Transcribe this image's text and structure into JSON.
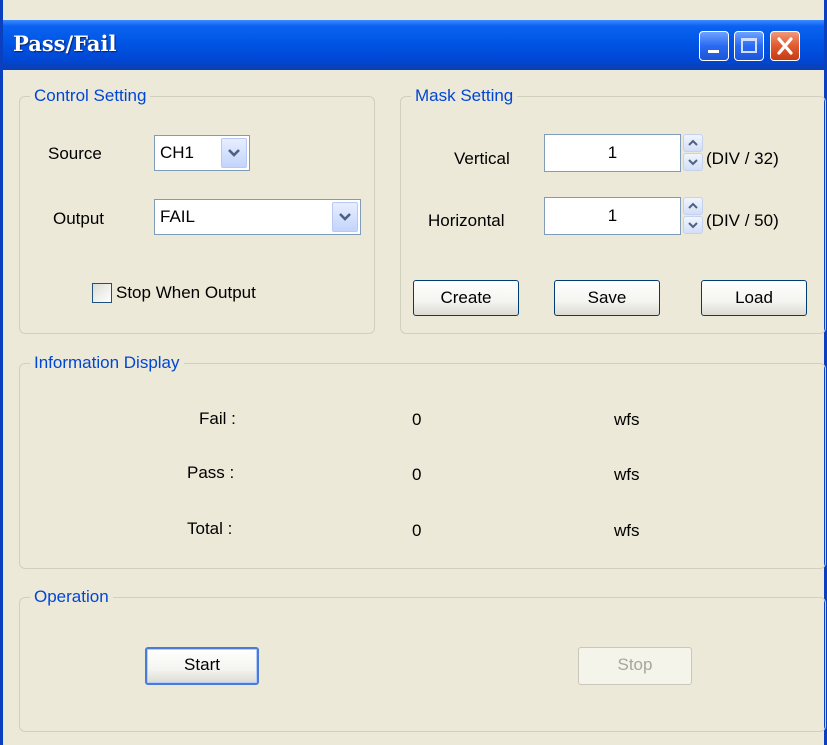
{
  "window": {
    "title": "Pass/Fail"
  },
  "control_setting": {
    "legend": "Control Setting",
    "source_label": "Source",
    "source_value": "CH1",
    "output_label": "Output",
    "output_value": "FAIL",
    "stop_when_output_label": "Stop When Output",
    "stop_when_output_checked": false
  },
  "mask_setting": {
    "legend": "Mask Setting",
    "vertical_label": "Vertical",
    "vertical_value": "1",
    "vertical_unit": "(DIV / 32)",
    "horizontal_label": "Horizontal",
    "horizontal_value": "1",
    "horizontal_unit": "(DIV / 50)",
    "create_label": "Create",
    "save_label": "Save",
    "load_label": "Load"
  },
  "information_display": {
    "legend": "Information Display",
    "rows": [
      {
        "label": "Fail :",
        "value": "0",
        "unit": "wfs"
      },
      {
        "label": "Pass :",
        "value": "0",
        "unit": "wfs"
      },
      {
        "label": "Total :",
        "value": "0",
        "unit": "wfs"
      }
    ]
  },
  "operation": {
    "legend": "Operation",
    "start_label": "Start",
    "stop_label": "Stop",
    "stop_enabled": false
  },
  "colors": {
    "titlebar": "#0055e5",
    "legend_text": "#0046d5",
    "dialog_bg": "#ece9d8"
  }
}
